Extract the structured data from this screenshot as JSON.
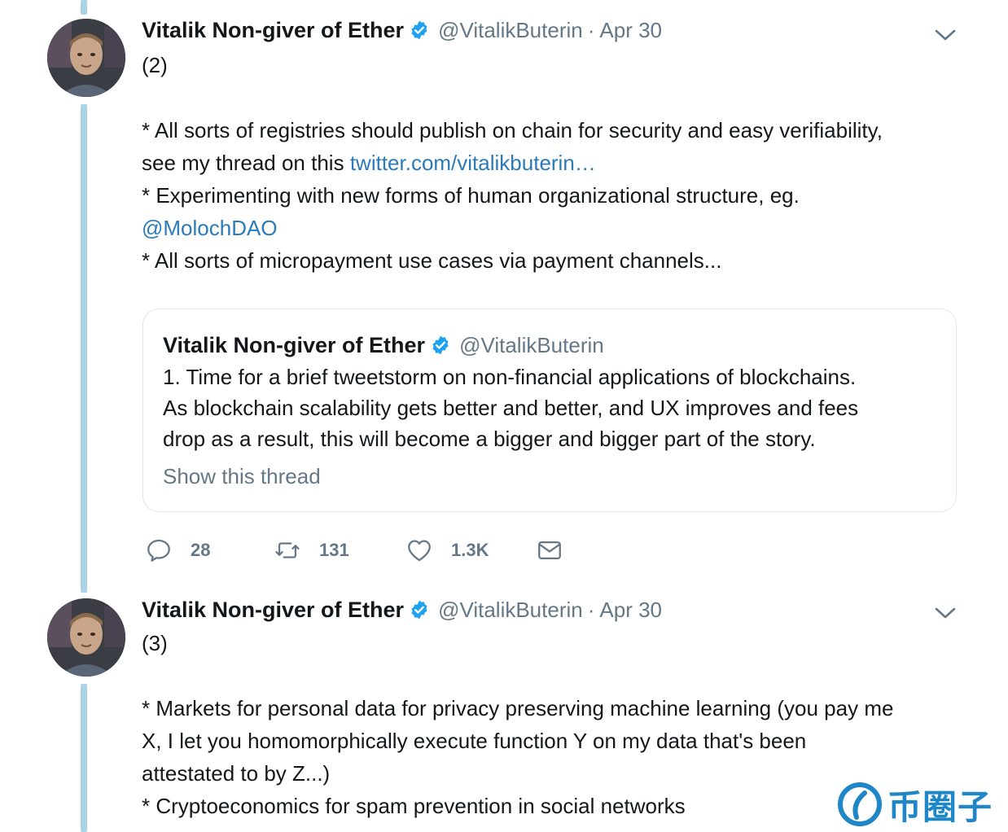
{
  "tweets": [
    {
      "display_name": "Vitalik Non-giver of Ether",
      "handle": "@VitalikButerin",
      "separator": "·",
      "date": "Apr 30",
      "body": {
        "number": "(2)",
        "line1": "* All sorts of registries should publish on chain for security and easy verifiability,",
        "line2_prefix": "see my thread on this ",
        "line2_link": "twitter.com/vitalikbuterin…",
        "line3": "* Experimenting with new forms of human organizational structure, eg.",
        "line4_mention": "@MolochDAO",
        "line5": "* All sorts of micropayment use cases via payment channels..."
      },
      "quote": {
        "display_name": "Vitalik Non-giver of Ether",
        "handle": "@VitalikButerin",
        "lines": [
          "1. Time for a brief tweetstorm on non-financial applications of blockchains.",
          "As blockchain scalability gets better and better, and UX improves and fees",
          "drop as a result, this will become a bigger and bigger part of the story."
        ],
        "show_thread": "Show this thread"
      },
      "actions": {
        "replies": "28",
        "retweets": "131",
        "likes": "1.3K"
      }
    },
    {
      "display_name": "Vitalik Non-giver of Ether",
      "handle": "@VitalikButerin",
      "separator": "·",
      "date": "Apr 30",
      "body": {
        "number": "(3)",
        "line1": "* Markets for personal data for privacy preserving machine learning (you pay me",
        "line2": "X, I let you homomorphically execute function Y on my data that's been",
        "line3": "attestated to by Z...)",
        "line4": "* Cryptoeconomics for spam prevention in social networks"
      }
    }
  ],
  "watermark": {
    "text": "币圈子"
  },
  "colors": {
    "link": "#2b7bb9",
    "secondary": "#657786",
    "thread_line": "#aad4e6",
    "verified": "#1da1f2"
  }
}
